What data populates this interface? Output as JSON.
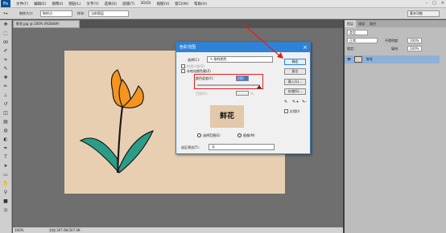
{
  "app": {
    "logo": "Ps"
  },
  "menu": [
    "文件(F)",
    "编辑(E)",
    "图像(I)",
    "图层(L)",
    "文字(Y)",
    "选择(S)",
    "滤镜(T)",
    "3D(D)",
    "视图(V)",
    "窗口(W)",
    "帮助(H)"
  ],
  "window_controls": [
    "–",
    "□",
    "×"
  ],
  "options": {
    "sample_size_label": "取样大小:",
    "sample_size_value": "取样点",
    "sample_label": "样本:",
    "sample_value": "当前图层",
    "workspace": "基本功能"
  },
  "document": {
    "tab_label": "鲜花.jpg @ 100% (RGB/8#)",
    "zoom": "100%",
    "doc_info": "文档:307.0K/307.0K"
  },
  "panels": {
    "tabs": [
      "图层",
      "通道",
      "路径"
    ],
    "kind_value": "类型",
    "blend_mode": "正常",
    "opacity_label": "不透明度:",
    "opacity_value": "100%",
    "lock_label": "锁定:",
    "fill_label": "填充:",
    "fill_value": "100%",
    "layer_name": "鲜花"
  },
  "dialog": {
    "title": "色彩范围",
    "select_label": "选择(C):",
    "select_value": "取样颜色",
    "detect_faces": "检测人脸(D)",
    "localized_clusters": "本地化颜色簇(Z)",
    "fuzziness_label": "颜色容差(F):",
    "fuzziness_value": "200",
    "range_label": "范围(R):",
    "range_unit": "%",
    "preview_text": "鲜花",
    "selection_radio": "选择范围(E)",
    "image_radio": "图像(M)",
    "selection_preview_label": "选区预览(T):",
    "selection_preview_value": "无",
    "ok": "确定",
    "cancel": "复位",
    "load": "载入(L)...",
    "save": "存储(S)...",
    "invert": "反相(I)"
  },
  "colors": {
    "canvas": "#e9cfb2",
    "petal": "#f5941e",
    "leaf": "#2a9d87",
    "stem": "#1b1b1b",
    "dialog_title": "#2f83d6",
    "highlight": "#e02020"
  }
}
